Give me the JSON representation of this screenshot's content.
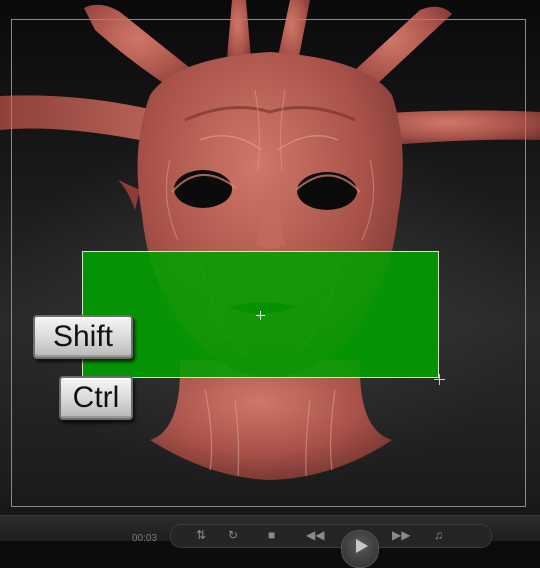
{
  "modifier_keys": {
    "shift_label": "Shift",
    "ctrl_label": "Ctrl"
  },
  "player": {
    "time": "00:03"
  },
  "colors": {
    "mask_selection": "#00a000",
    "sculpt_surface": "#b65a4e",
    "key_face": "#e0e0e0"
  },
  "icons": {
    "rewind": "rewind-icon",
    "play": "play-icon",
    "forward": "fast-forward-icon",
    "volume": "volume-icon",
    "stop": "stop-icon"
  }
}
